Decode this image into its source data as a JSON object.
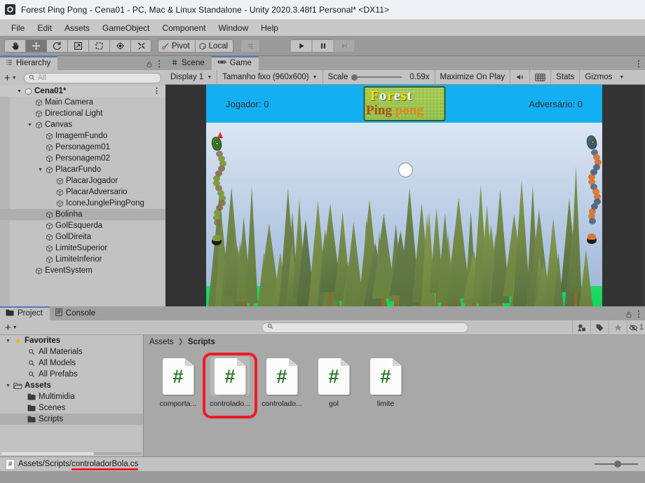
{
  "window": {
    "title": "Forest Ping Pong - Cena01 - PC, Mac & Linux Standalone - Unity 2020.3.48f1 Personal* <DX11>",
    "logo_icon": "unity-logo-icon"
  },
  "menubar": {
    "items": [
      {
        "label": "File"
      },
      {
        "label": "Edit"
      },
      {
        "label": "Assets"
      },
      {
        "label": "GameObject"
      },
      {
        "label": "Component"
      },
      {
        "label": "Window"
      },
      {
        "label": "Help"
      }
    ]
  },
  "toolbar": {
    "tools": [
      {
        "name": "hand-tool-icon",
        "active": false
      },
      {
        "name": "move-tool-icon",
        "active": true
      },
      {
        "name": "rotate-tool-icon",
        "active": false
      },
      {
        "name": "scale-tool-icon",
        "active": false
      },
      {
        "name": "rect-tool-icon",
        "active": false
      },
      {
        "name": "transform-tool-icon",
        "active": false
      },
      {
        "name": "custom-tool-icon",
        "active": false
      }
    ],
    "pivot_label": "Pivot",
    "local_label": "Local",
    "grid_icon": "grid-snap-icon",
    "play_label": "play-button-icon",
    "pause_label": "pause-button-icon",
    "step_label": "step-button-icon"
  },
  "hierarchy": {
    "tab_label": "Hierarchy",
    "tab_icon": "hierarchy-icon",
    "lock_icon": "lock-icon",
    "menu_icon": "kebab-menu-icon",
    "add_label": "+",
    "search_placeholder": "All",
    "search_value": "",
    "scene_name": "Cena01*",
    "items": [
      {
        "label": "Main Camera",
        "depth": 1,
        "expandable": false,
        "expanded": false,
        "selected": false
      },
      {
        "label": "Directional Light",
        "depth": 1,
        "expandable": false,
        "expanded": false,
        "selected": false
      },
      {
        "label": "Canvas",
        "depth": 1,
        "expandable": true,
        "expanded": true,
        "selected": false
      },
      {
        "label": "ImagemFundo",
        "depth": 2,
        "expandable": false,
        "expanded": false,
        "selected": false
      },
      {
        "label": "Personagem01",
        "depth": 2,
        "expandable": false,
        "expanded": false,
        "selected": false
      },
      {
        "label": "Personagem02",
        "depth": 2,
        "expandable": false,
        "expanded": false,
        "selected": false
      },
      {
        "label": "PlacarFundo",
        "depth": 2,
        "expandable": true,
        "expanded": true,
        "selected": false
      },
      {
        "label": "PlacarJogador",
        "depth": 3,
        "expandable": false,
        "expanded": false,
        "selected": false
      },
      {
        "label": "PlacarAdversario",
        "depth": 3,
        "expandable": false,
        "expanded": false,
        "selected": false
      },
      {
        "label": "IconeJunglePingPong",
        "depth": 3,
        "expandable": false,
        "expanded": false,
        "selected": false
      },
      {
        "label": "Bolinha",
        "depth": 2,
        "expandable": false,
        "expanded": false,
        "selected": true
      },
      {
        "label": "GolEsquerda",
        "depth": 2,
        "expandable": false,
        "expanded": false,
        "selected": false
      },
      {
        "label": "GolDireita",
        "depth": 2,
        "expandable": false,
        "expanded": false,
        "selected": false
      },
      {
        "label": "LimiteSuperior",
        "depth": 2,
        "expandable": false,
        "expanded": false,
        "selected": false
      },
      {
        "label": "LimiteInferior",
        "depth": 2,
        "expandable": false,
        "expanded": false,
        "selected": false
      },
      {
        "label": "EventSystem",
        "depth": 1,
        "expandable": false,
        "expanded": false,
        "selected": false
      }
    ]
  },
  "sceneview": {
    "tabs": [
      {
        "label": "Scene",
        "icon": "scene-grid-icon",
        "active": false
      },
      {
        "label": "Game",
        "icon": "gamepad-icon",
        "active": true
      }
    ],
    "menu_icon": "kebab-menu-icon",
    "display_label": "Display 1",
    "resolution_label": "Tamanho fixo (960x600)",
    "scale_label": "Scale",
    "scale_value": "0.59x",
    "maximize_label": "Maximize On Play",
    "mute_icon": "mute-audio-icon",
    "stats_label": "Stats",
    "gizmos_label": "Gizmos"
  },
  "game": {
    "player_score_label": "Jogador: 0",
    "opponent_score_label": "Adversário: 0",
    "logo_line1": "Forest",
    "logo_line2": "Ping pong",
    "ball_name": "ball",
    "left_character": "green-snake-character",
    "right_character": "orange-snake-character",
    "sky_color": "#aec3e0",
    "score_bar_color": "#12b0f3",
    "grass_color": "#12c455"
  },
  "project": {
    "tabs": [
      {
        "label": "Project",
        "icon": "folder-icon",
        "active": true
      },
      {
        "label": "Console",
        "icon": "console-icon",
        "active": false
      }
    ],
    "lock_icon": "lock-icon",
    "menu_icon": "kebab-menu-icon",
    "add_label": "+",
    "search_placeholder": "",
    "search_value": "",
    "filter_icons": [
      {
        "name": "filter-by-type-icon"
      },
      {
        "name": "filter-by-label-icon"
      },
      {
        "name": "favorites-star-icon"
      },
      {
        "name": "hidden-packages-icon",
        "badge": "1"
      }
    ],
    "tree": [
      {
        "label": "Favorites",
        "depth": 0,
        "kind": "favorites",
        "expanded": true,
        "selected": false
      },
      {
        "label": "All Materials",
        "depth": 1,
        "kind": "search",
        "expanded": false,
        "selected": false
      },
      {
        "label": "All Models",
        "depth": 1,
        "kind": "search",
        "expanded": false,
        "selected": false
      },
      {
        "label": "All Prefabs",
        "depth": 1,
        "kind": "search",
        "expanded": false,
        "selected": false
      },
      {
        "label": "Assets",
        "depth": 0,
        "kind": "folder-open",
        "expanded": true,
        "selected": false
      },
      {
        "label": "Multimidia",
        "depth": 1,
        "kind": "folder",
        "expanded": false,
        "selected": false
      },
      {
        "label": "Scenes",
        "depth": 1,
        "kind": "folder",
        "expanded": false,
        "selected": false
      },
      {
        "label": "Scripts",
        "depth": 1,
        "kind": "folder",
        "expanded": false,
        "selected": true
      }
    ],
    "breadcrumb": [
      {
        "label": "Assets",
        "current": false
      },
      {
        "label": "Scripts",
        "current": true
      }
    ],
    "assets": [
      {
        "label": "comporta...",
        "icon": "csharp-script-icon",
        "selected": false,
        "highlighted": false
      },
      {
        "label": "controlado...",
        "icon": "csharp-script-icon",
        "selected": true,
        "highlighted": true
      },
      {
        "label": "controlado...",
        "icon": "csharp-script-icon",
        "selected": false,
        "highlighted": false
      },
      {
        "label": "gol",
        "icon": "csharp-script-icon",
        "selected": false,
        "highlighted": false
      },
      {
        "label": "limite",
        "icon": "csharp-script-icon",
        "selected": false,
        "highlighted": false
      }
    ]
  },
  "statusbar": {
    "icon": "csharp-script-icon",
    "path_prefix": "Assets/Scripts/",
    "path_highlight": "controladorBola.cs",
    "zoom_slider_icon": "zoom-slider"
  },
  "colors": {
    "accent_red": "#ee1b24",
    "csharp_green": "#2f7d32",
    "tab_accent": "#4b7fb5"
  }
}
